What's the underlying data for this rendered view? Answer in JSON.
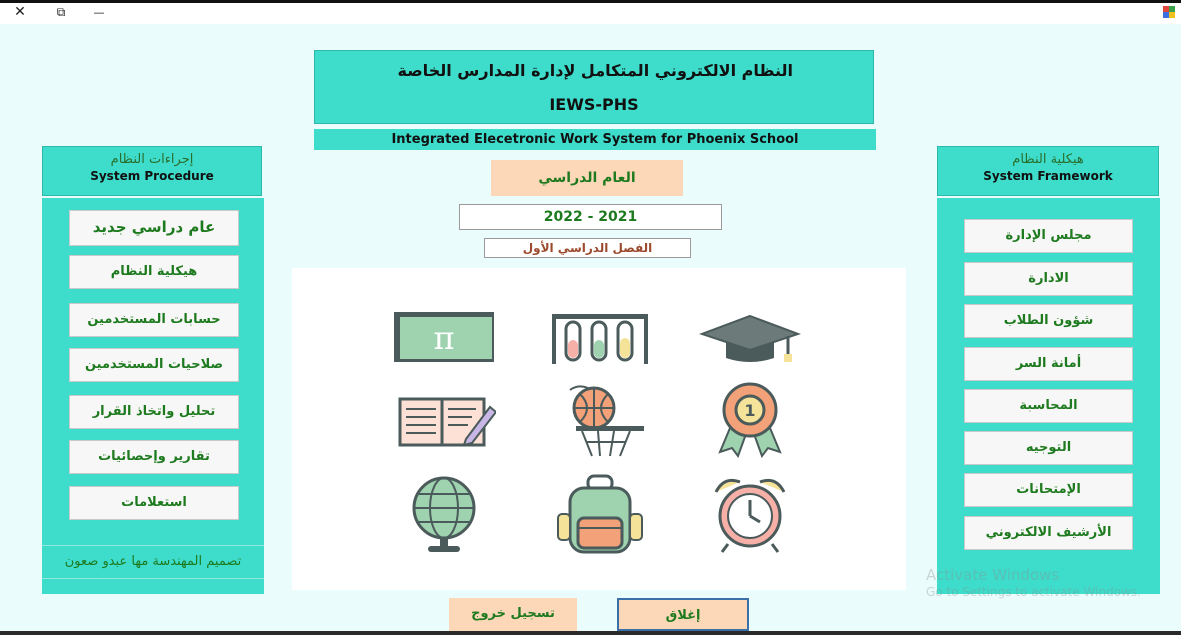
{
  "window": {
    "close_glyph": "✕",
    "restore_glyph": "⧉",
    "minimize_glyph": "—"
  },
  "header": {
    "title_ar": "النظام الالكتروني المتكامل لإدارة المدارس الخاصة",
    "code": "IEWS-PHS",
    "subtitle_en": "Integrated Elecetronic Work System for Phoenix School"
  },
  "academic": {
    "label": "العام الدراسي",
    "year": "2022 - 2021",
    "term": "الفصل الدراسي الأول"
  },
  "left_panel": {
    "title_ar": "إجراءات النظام",
    "title_en": "System Procedure",
    "buttons": [
      "عام دراسي جديد",
      "هيكلية النظام",
      "حسابات المستخدمين",
      "صلاحيات المستخدمين",
      "تحليل واتخاذ القرار",
      "تقارير وإحصائيات",
      "استعلامات"
    ],
    "credit": "تصميم المهندسة مها عبدو صعون"
  },
  "right_panel": {
    "title_ar": "هيكلية النظام",
    "title_en": "System  Framework",
    "buttons": [
      "مجلس الإدارة",
      "الادارة",
      "شؤون الطلاب",
      "أمانة السر",
      "المحاسبة",
      "التوجيه",
      "الإمتحانات",
      "الأرشيف الالكتروني"
    ]
  },
  "icons": [
    "chalkboard-pi-icon",
    "test-tubes-icon",
    "graduation-cap-icon",
    "open-book-pencil-icon",
    "basketball-hoop-icon",
    "medal-badge-icon",
    "globe-icon",
    "backpack-icon",
    "alarm-clock-icon"
  ],
  "footer": {
    "logout": "تسجيل خروج",
    "close": "إغلاق"
  },
  "watermark": {
    "line1": "Activate Windows",
    "line2": "Go to Settings to activate Windows."
  }
}
